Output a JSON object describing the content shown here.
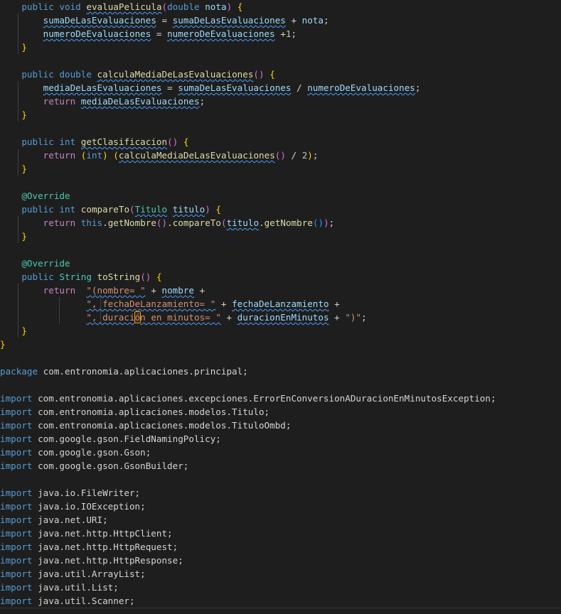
{
  "editor": {
    "theme": "dark-plus",
    "background": "#1e1e1e",
    "foreground": "#d4d4d4",
    "font_size_px": 12.6,
    "line_height_px": 19,
    "colors": {
      "keyword": "#569cd6",
      "control": "#c586c0",
      "type": "#4ec9b0",
      "function": "#dcdcaa",
      "variable": "#9cdcfe",
      "string": "#ce9178",
      "number": "#b5cea8",
      "operator": "#d4d4d4",
      "bracket_level_1": "#ffd700",
      "bracket_level_2": "#da70d6",
      "bracket_level_3": "#179fff",
      "squiggle": "#4a9eff",
      "indent_guide": "#404040",
      "divider": "#333333",
      "find_match_border": "#f0a000"
    }
  },
  "pane_top": {
    "language": "java",
    "lines": [
      "    public void evaluaPelicula(double nota) {",
      "        sumaDeLasEvaluaciones = sumaDeLasEvaluaciones + nota;",
      "        numeroDeEvaluaciones = numeroDeEvaluaciones +1;",
      "    }",
      "",
      "    public double calculaMediaDeLasEvaluaciones() {",
      "        mediaDeLasEvaluaciones = sumaDeLasEvaluaciones / numeroDeEvaluaciones;",
      "        return mediaDeLasEvaluaciones;",
      "    }",
      "",
      "    public int getClasificacion() {",
      "        return (int) (calculaMediaDeLasEvaluaciones() / 2);",
      "    }",
      "",
      "    @Override",
      "    public int compareTo(Titulo titulo) {",
      "        return this.getNombre().compareTo(titulo.getNombre());",
      "    }",
      "",
      "    @Override",
      "    public String toString() {",
      "        return  \"(nombre= \" + nombre +",
      "                \", fechaDeLanzamiento= \" + fechaDeLanzamiento +",
      "                \", duración en minutos= \" + duracionEnMinutos + \")\";",
      "    }",
      "}"
    ]
  },
  "pane_bottom": {
    "language": "java",
    "lines": [
      "package com.entronomia.aplicaciones.principal;",
      "",
      "import com.entronomia.aplicaciones.excepciones.ErrorEnConversionADuracionEnMinutosException;",
      "import com.entronomia.aplicaciones.modelos.Titulo;",
      "import com.entronomia.aplicaciones.modelos.TituloOmbd;",
      "import com.google.gson.FieldNamingPolicy;",
      "import com.google.gson.Gson;",
      "import com.google.gson.GsonBuilder;",
      "",
      "import java.io.FileWriter;",
      "import java.io.IOException;",
      "import java.net.URI;",
      "import java.net.http.HttpClient;",
      "import java.net.http.HttpRequest;",
      "import java.net.http.HttpResponse;",
      "import java.util.ArrayList;",
      "import java.util.List;",
      "import java.util.Scanner;"
    ]
  },
  "tokens": {
    "kw_public": "public",
    "kw_void": "void",
    "kw_double": "double",
    "kw_int": "int",
    "kw_return": "return",
    "kw_this": "this",
    "kw_import": "import",
    "kw_package": "package",
    "type_string": "String",
    "type_titulo": "Titulo",
    "annotation_override": "@Override",
    "fn_evalua_pelicula": "evaluaPelicula",
    "fn_calcula_media": "calculaMediaDeLasEvaluaciones",
    "fn_get_clasificacion": "getClasificacion",
    "fn_compare_to": "compareTo",
    "fn_to_string": "toString",
    "fn_get_nombre": "getNombre",
    "var_nota": "nota",
    "var_suma": "sumaDeLasEvaluaciones",
    "var_numero": "numeroDeEvaluaciones",
    "var_media": "mediaDeLasEvaluaciones",
    "var_titulo": "titulo",
    "var_nombre": "nombre",
    "var_fecha": "fechaDeLanzamiento",
    "var_duracion": "duracionEnMinutos",
    "num_1": "1",
    "num_2": "2",
    "str_nombre": "\"(nombre= \"",
    "str_fecha": "\", fechaDeLanzamiento= \"",
    "str_duracion_a": "\", duraci",
    "str_duracion_match": "ó",
    "str_duracion_b": "n en minutos= \"",
    "str_close_paren": "\")\"",
    "pkg_principal": " com.entronomia.aplicaciones.principal;",
    "imp_excepciones": " com.entronomia.aplicaciones.excepciones.ErrorEnConversionADuracionEnMinutosException;",
    "imp_titulo": " com.entronomia.aplicaciones.modelos.Titulo;",
    "imp_titulo_ombd": " com.entronomia.aplicaciones.modelos.TituloOmbd;",
    "imp_field_naming": " com.google.gson.FieldNamingPolicy;",
    "imp_gson": " com.google.gson.Gson;",
    "imp_gson_builder": " com.google.gson.GsonBuilder;",
    "imp_filewriter": " java.io.FileWriter;",
    "imp_ioexception": " java.io.IOException;",
    "imp_uri": " java.net.URI;",
    "imp_httpclient": " java.net.http.HttpClient;",
    "imp_httprequest": " java.net.http.HttpRequest;",
    "imp_httpresponse": " java.net.http.HttpResponse;",
    "imp_arraylist": " java.util.ArrayList;",
    "imp_list": " java.util.List;",
    "imp_scanner": " java.util.Scanner;"
  }
}
